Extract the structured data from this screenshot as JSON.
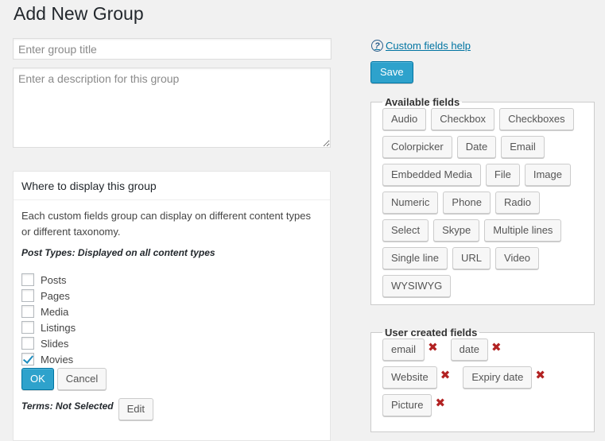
{
  "page": {
    "title": "Add New Group"
  },
  "form": {
    "title_placeholder": "Enter group title",
    "description_placeholder": "Enter a description for this group"
  },
  "display_box": {
    "heading": "Where to display this group",
    "intro": "Each custom fields group can display on different content types or different taxonomy.",
    "post_types_label": "Post Types: Displayed on all content types",
    "post_types": [
      {
        "label": "Posts",
        "checked": false
      },
      {
        "label": "Pages",
        "checked": false
      },
      {
        "label": "Media",
        "checked": false
      },
      {
        "label": "Listings",
        "checked": false
      },
      {
        "label": "Slides",
        "checked": false
      },
      {
        "label": "Movies",
        "checked": true
      }
    ],
    "ok_label": "OK",
    "cancel_label": "Cancel",
    "terms_label": "Terms: Not Selected",
    "edit_label": "Edit"
  },
  "sidebar": {
    "help_label": "Custom fields help",
    "save_label": "Save",
    "available_legend": "Available fields",
    "available_fields": [
      "Audio",
      "Checkbox",
      "Checkboxes",
      "Colorpicker",
      "Date",
      "Email",
      "Embedded Media",
      "File",
      "Image",
      "Numeric",
      "Phone",
      "Radio",
      "Select",
      "Skype",
      "Multiple lines",
      "Single line",
      "URL",
      "Video",
      "WYSIWYG"
    ],
    "user_created_legend": "User created fields",
    "user_created_fields": [
      "email",
      "date",
      "Website",
      "Expiry date",
      "Picture"
    ]
  },
  "colors": {
    "primary_button": "#2ea2cc",
    "link": "#0074a2",
    "delete_icon": "#b22222",
    "background": "#f1f1f1"
  },
  "icons": {
    "help": "question-circle-icon",
    "delete": "delete-x-icon",
    "checkbox_checked": "checkmark-icon"
  }
}
